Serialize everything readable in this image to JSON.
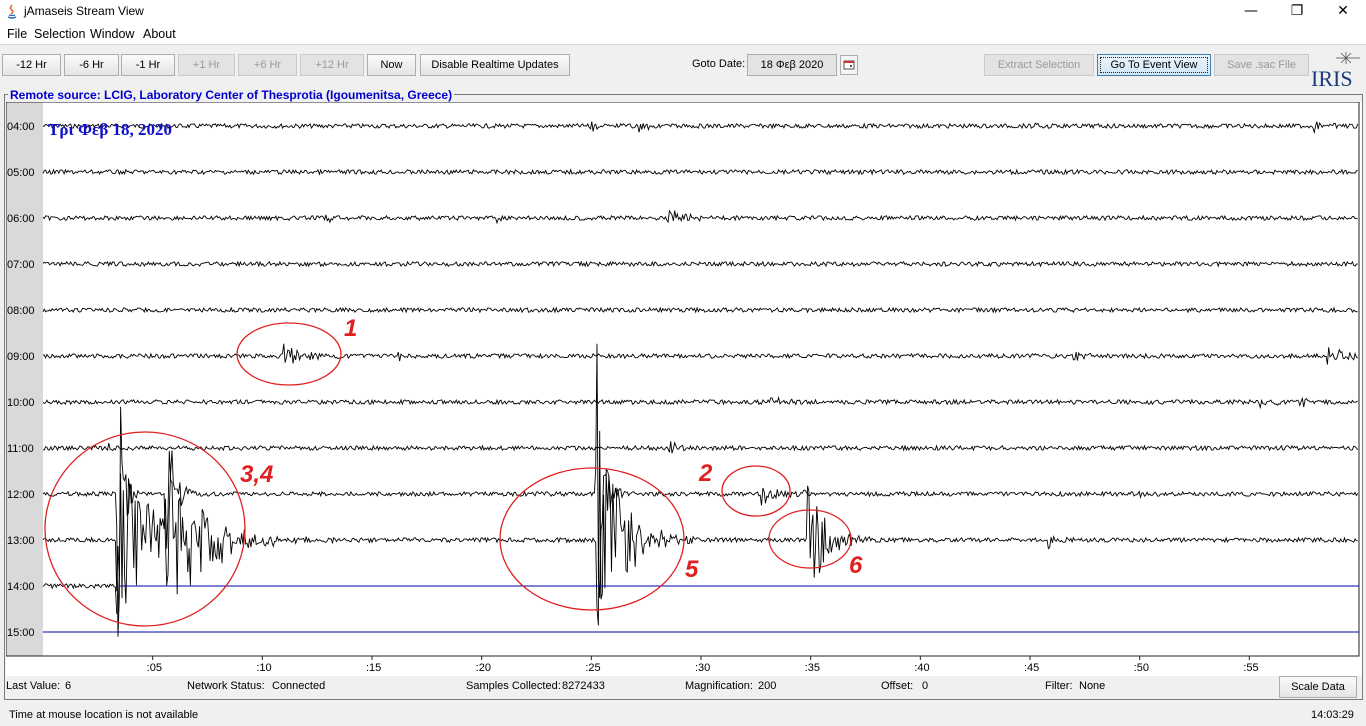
{
  "window": {
    "title": "jAmaseis Stream View",
    "controls": {
      "minimize": "—",
      "maximize": "❐",
      "close": "✕"
    }
  },
  "menu": [
    "File",
    "Selection",
    "Window",
    "About"
  ],
  "toolbar": {
    "buttons": [
      {
        "label": "-12 Hr",
        "enabled": true
      },
      {
        "label": "-6 Hr",
        "enabled": true
      },
      {
        "label": "-1 Hr",
        "enabled": true
      },
      {
        "label": "+1 Hr",
        "enabled": false
      },
      {
        "label": "+6 Hr",
        "enabled": false
      },
      {
        "label": "+12 Hr",
        "enabled": false
      },
      {
        "label": "Now",
        "enabled": true
      },
      {
        "label": "Disable Realtime Updates",
        "enabled": true
      }
    ],
    "goto_label": "Goto Date:",
    "goto_value": "18 Φεβ 2020",
    "extract_label": "Extract Selection",
    "event_label": "Go To Event View",
    "save_label": "Save .sac File",
    "logo_text": "IRIS"
  },
  "source": {
    "label": "Remote source: LCIG, Laboratory Center of Thesprotia (Igoumenitsa, Greece)",
    "date_text": "Τρι Φεβ 18, 2020"
  },
  "rows": [
    "04:00",
    "05:00",
    "06:00",
    "07:00",
    "08:00",
    "09:00",
    "10:00",
    "11:00",
    "12:00",
    "13:00",
    "14:00",
    "15:00"
  ],
  "x_ticks": [
    ":05",
    ":10",
    ":15",
    ":20",
    ":25",
    ":30",
    ":35",
    ":40",
    ":45",
    ":50",
    ":55"
  ],
  "annotations": [
    "1",
    "2",
    "3,4",
    "5",
    "6"
  ],
  "colors": {
    "trace": "#000000",
    "future_line": "#0000aa",
    "annotation": "#e02020",
    "source_label": "#0000cc",
    "date_label": "#1010cc"
  },
  "status": {
    "last_value_label": "Last Value:",
    "last_value": "6",
    "network_label": "Network Status:",
    "network_value": "Connected",
    "samples_label": "Samples Collected:",
    "samples_value": "8272433",
    "magnification_label": "Magnification:",
    "magnification_value": "200",
    "offset_label": "Offset:",
    "offset_value": "0",
    "filter_label": "Filter:",
    "filter_value": "None",
    "scale_button": "Scale Data"
  },
  "footer": {
    "mouse_text": "Time at mouse location is not available",
    "clock": "14:03:29"
  }
}
